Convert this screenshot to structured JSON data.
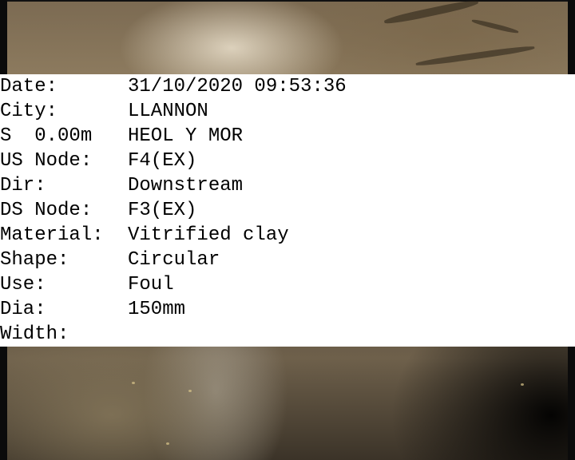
{
  "overlay": {
    "rows": [
      {
        "label": "Date:",
        "value": "31/10/2020 09:53:36"
      },
      {
        "label": "City:",
        "value": "LLANNON"
      },
      {
        "label": "S  0.00m",
        "value": "HEOL Y MOR"
      },
      {
        "label": "US Node:",
        "value": "F4(EX)"
      },
      {
        "label": "Dir:",
        "value": "Downstream"
      },
      {
        "label": "DS Node:",
        "value": "F3(EX)"
      },
      {
        "label": "Material:",
        "value": "Vitrified clay"
      },
      {
        "label": "Shape:",
        "value": "Circular"
      },
      {
        "label": "Use:",
        "value": "Foul"
      },
      {
        "label": "Dia:",
        "value": "150mm"
      },
      {
        "label": "Width:",
        "value": ""
      }
    ]
  },
  "colors": {
    "overlay_background": "#ffffff",
    "overlay_text": "#000000"
  }
}
